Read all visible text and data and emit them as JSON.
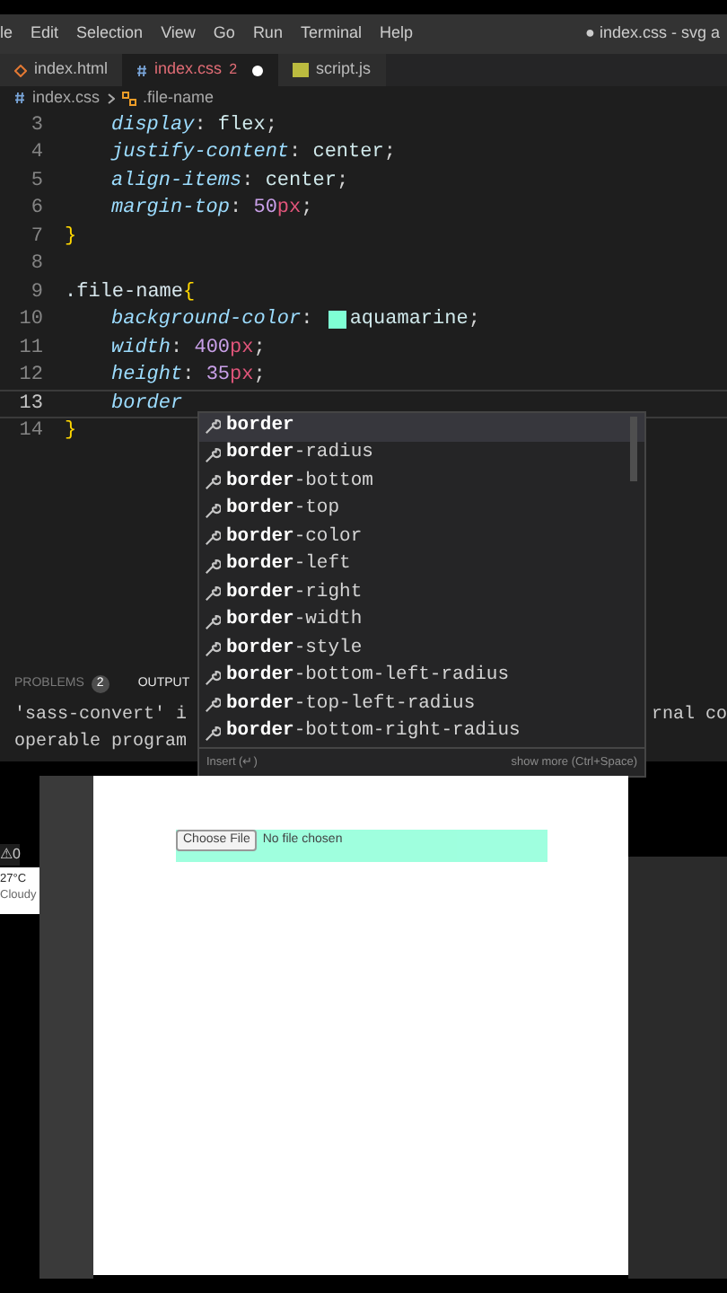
{
  "menu_bar": {
    "items": [
      "le",
      "Edit",
      "Selection",
      "View",
      "Go",
      "Run",
      "Terminal",
      "Help"
    ],
    "title": "● index.css - svg a"
  },
  "tabs": [
    {
      "label": "index.html",
      "kind": "html",
      "selected": false,
      "modified": false
    },
    {
      "label": "index.css",
      "kind": "css",
      "selected": true,
      "modified": true,
      "badge": "2"
    },
    {
      "label": "script.js",
      "kind": "js",
      "selected": false,
      "modified": false
    }
  ],
  "breadcrumb": {
    "file": "index.css",
    "symbol": ".file-name"
  },
  "code_lines": [
    {
      "number": "3",
      "current": false,
      "indent": true,
      "tokens": [
        {
          "kind": "prop",
          "text": "display"
        },
        {
          "kind": "punct",
          "text": ": "
        },
        {
          "kind": "value",
          "text": "flex"
        },
        {
          "kind": "punct",
          "text": ";"
        }
      ]
    },
    {
      "number": "4",
      "current": false,
      "indent": true,
      "tokens": [
        {
          "kind": "prop",
          "text": "justify-content"
        },
        {
          "kind": "punct",
          "text": ": "
        },
        {
          "kind": "value",
          "text": "center"
        },
        {
          "kind": "punct",
          "text": ";"
        }
      ]
    },
    {
      "number": "5",
      "current": false,
      "indent": true,
      "tokens": [
        {
          "kind": "prop",
          "text": "align-items"
        },
        {
          "kind": "punct",
          "text": ": "
        },
        {
          "kind": "value",
          "text": "center"
        },
        {
          "kind": "punct",
          "text": ";"
        }
      ]
    },
    {
      "number": "6",
      "current": false,
      "indent": true,
      "tokens": [
        {
          "kind": "prop",
          "text": "margin-top"
        },
        {
          "kind": "punct",
          "text": ": "
        },
        {
          "kind": "number",
          "text": "50"
        },
        {
          "kind": "unit",
          "text": "px"
        },
        {
          "kind": "punct",
          "text": ";"
        }
      ]
    },
    {
      "number": "7",
      "current": false,
      "indent": false,
      "tokens": [
        {
          "kind": "brace",
          "text": "}"
        }
      ]
    },
    {
      "number": "8",
      "current": false
    },
    {
      "number": "9",
      "current": false,
      "indent": false,
      "tokens": [
        {
          "kind": "selector",
          "text": ".file-name"
        },
        {
          "kind": "brace",
          "text": "{"
        }
      ]
    },
    {
      "number": "10",
      "current": false,
      "indent": true,
      "tokens": [
        {
          "kind": "prop",
          "text": "background-color"
        },
        {
          "kind": "punct",
          "text": ": "
        },
        {
          "kind": "swatch",
          "color": "#7fffd4"
        },
        {
          "kind": "value",
          "text": "aquamarine"
        },
        {
          "kind": "punct",
          "text": ";"
        }
      ]
    },
    {
      "number": "11",
      "current": false,
      "indent": true,
      "tokens": [
        {
          "kind": "prop",
          "text": "width"
        },
        {
          "kind": "punct",
          "text": ": "
        },
        {
          "kind": "number",
          "text": "400"
        },
        {
          "kind": "unit",
          "text": "px"
        },
        {
          "kind": "punct",
          "text": ";"
        }
      ]
    },
    {
      "number": "12",
      "current": false,
      "indent": true,
      "tokens": [
        {
          "kind": "prop",
          "text": "height"
        },
        {
          "kind": "punct",
          "text": ": "
        },
        {
          "kind": "number",
          "text": "35"
        },
        {
          "kind": "unit",
          "text": "px"
        },
        {
          "kind": "punct",
          "text": ";"
        }
      ]
    },
    {
      "number": "13",
      "current": true,
      "indent": true,
      "tokens": [
        {
          "kind": "prop",
          "text": "border"
        }
      ]
    },
    {
      "number": "14",
      "current": false,
      "indent": false,
      "tokens": [
        {
          "kind": "brace",
          "text": "}"
        }
      ]
    }
  ],
  "suggestions": {
    "items": [
      {
        "label": "**border**",
        "selected": true
      },
      {
        "label": "**border**-radius",
        "selected": false
      },
      {
        "label": "**border**-bottom",
        "selected": false
      },
      {
        "label": "**border**-top",
        "selected": false
      },
      {
        "label": "**border**-color",
        "selected": false
      },
      {
        "label": "**border**-left",
        "selected": false
      },
      {
        "label": "**border**-right",
        "selected": false
      },
      {
        "label": "**border**-width",
        "selected": false
      },
      {
        "label": "**border**-style",
        "selected": false
      },
      {
        "label": "**border**-bottom-left-radius",
        "selected": false
      },
      {
        "label": "**border**-top-left-radius",
        "selected": false
      },
      {
        "label": "**border**-bottom-right-radius",
        "selected": false
      }
    ],
    "footer_left": "Insert (↵)",
    "footer_right": "show more (Ctrl+Space)"
  },
  "panel": {
    "tabs": [
      {
        "label": "PROBLEMS",
        "badge": "2",
        "selected": false
      },
      {
        "label": "OUTPUT",
        "selected": true
      }
    ],
    "output_lines": [
      {
        "left": "'sass-convert' i",
        "right": "rnal co"
      },
      {
        "left": "operable program"
      }
    ]
  },
  "status": {
    "warnings": "⚠0"
  },
  "weather": {
    "temperature": "27°C",
    "condition": "Cloudy"
  },
  "browser": {
    "button": "Choose File",
    "status": "No file chosen"
  }
}
